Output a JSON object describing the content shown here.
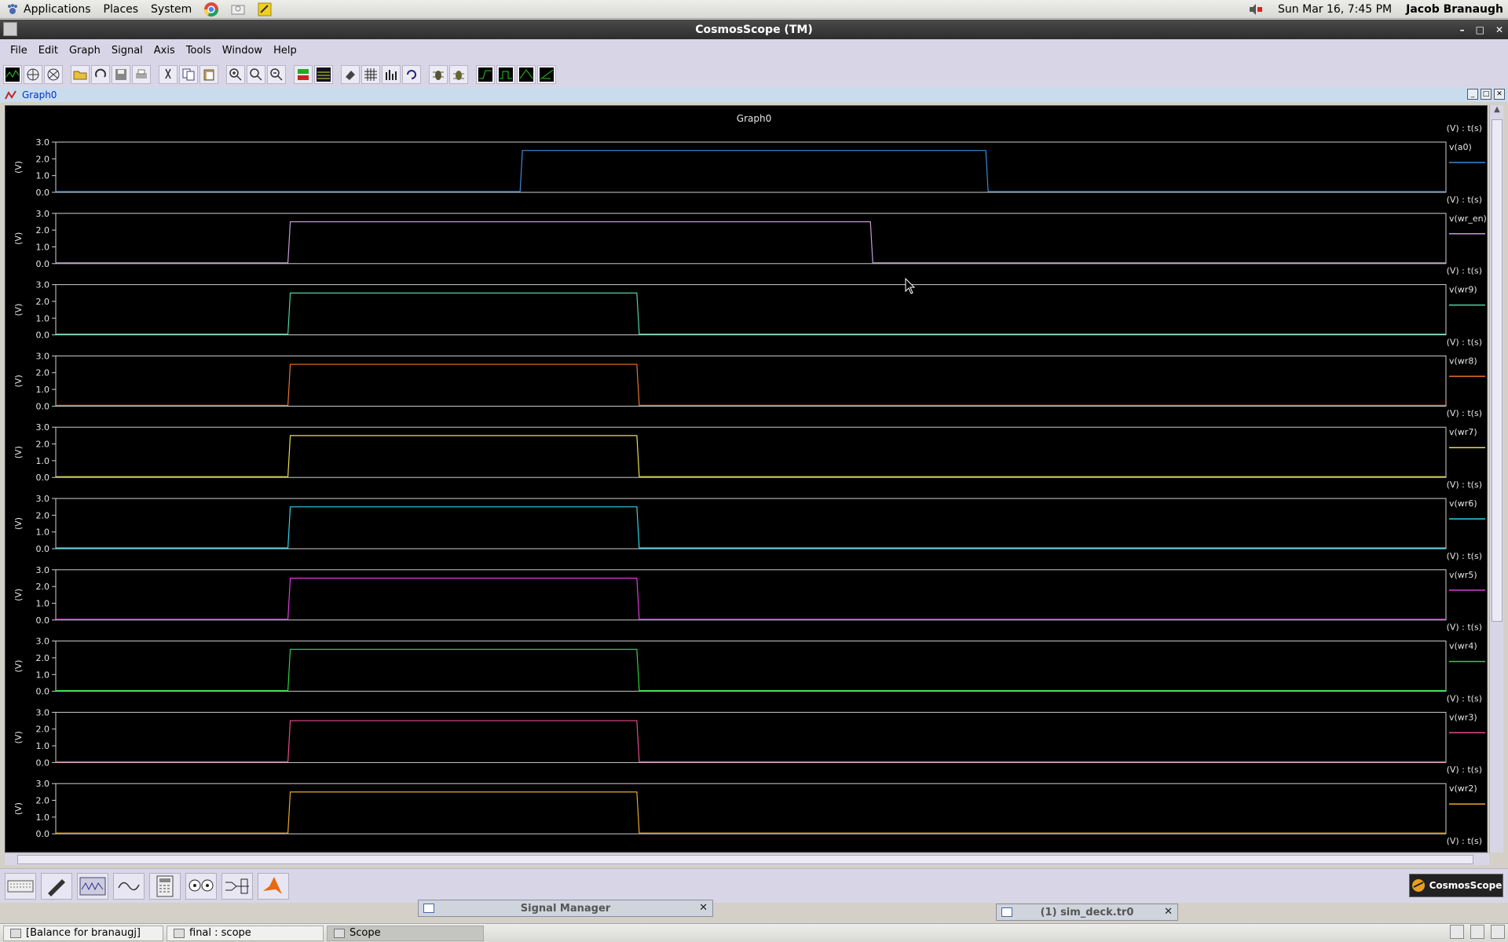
{
  "panel": {
    "menus": [
      "Applications",
      "Places",
      "System"
    ],
    "clock": "Sun Mar 16,  7:45 PM",
    "user": "Jacob Branaugh"
  },
  "window": {
    "title": "CosmosScope (TM)",
    "menus": [
      "File",
      "Edit",
      "Graph",
      "Signal",
      "Axis",
      "Tools",
      "Window",
      "Help"
    ]
  },
  "graph": {
    "frame_title": "Graph0",
    "plot_title": "Graph0",
    "ylabel": "(V)",
    "axis_units": "(V) : t(s)",
    "yticks": [
      "3.0",
      "2.0",
      "1.0",
      "0.0"
    ],
    "y_max": 3.0,
    "high_level": 2.5
  },
  "chart_data": {
    "type": "line",
    "title": "Graph0",
    "ylabel": "(V)",
    "ylim": [
      0,
      3.0
    ],
    "x_range": [
      0,
      1
    ],
    "series": [
      {
        "name": "v(a0)",
        "color": "#3a8ad8",
        "rise": 0.334,
        "fall": 0.669
      },
      {
        "name": "v(wr_en)",
        "color": "#c89ad8",
        "rise": 0.167,
        "fall": 0.586
      },
      {
        "name": "v(wr9)",
        "color": "#4dd6a0",
        "rise": 0.167,
        "fall": 0.418
      },
      {
        "name": "v(wr8)",
        "color": "#e8742a",
        "rise": 0.167,
        "fall": 0.418
      },
      {
        "name": "v(wr7)",
        "color": "#e8e04a",
        "rise": 0.167,
        "fall": 0.418
      },
      {
        "name": "v(wr6)",
        "color": "#2ad6e8",
        "rise": 0.167,
        "fall": 0.418
      },
      {
        "name": "v(wr5)",
        "color": "#e03ae0",
        "rise": 0.167,
        "fall": 0.418
      },
      {
        "name": "v(wr4)",
        "color": "#2ad43a",
        "rise": 0.167,
        "fall": 0.418
      },
      {
        "name": "v(wr3)",
        "color": "#e84a8a",
        "rise": 0.167,
        "fall": 0.418
      },
      {
        "name": "v(wr2)",
        "color": "#e8a82a",
        "rise": 0.167,
        "fall": 0.418
      }
    ]
  },
  "floating": {
    "signal_manager": "Signal Manager",
    "sim_deck": "(1) sim_deck.tr0"
  },
  "taskbar": {
    "items": [
      "[Balance for branaugj]",
      "final : scope",
      "Scope"
    ]
  },
  "brand_badge": "CosmosScope"
}
